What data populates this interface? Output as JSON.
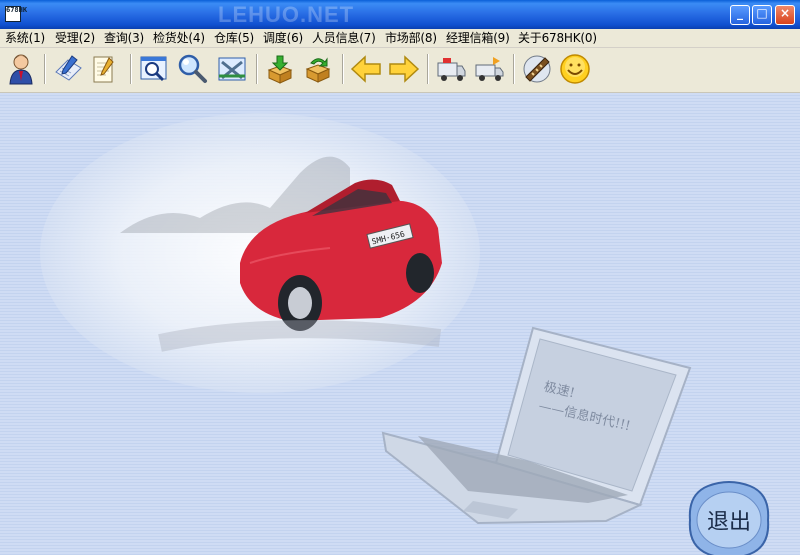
{
  "window": {
    "icon_text": "678HK",
    "watermark": "LEHUO.NET",
    "controls": {
      "minimize": "_",
      "maximize": "□",
      "close": "×"
    }
  },
  "menu": {
    "items": [
      {
        "label": "系统(1)"
      },
      {
        "label": "受理(2)"
      },
      {
        "label": "查询(3)"
      },
      {
        "label": "检货处(4)"
      },
      {
        "label": "仓库(5)"
      },
      {
        "label": "调度(6)"
      },
      {
        "label": "人员信息(7)"
      },
      {
        "label": "市场部(8)"
      },
      {
        "label": "经理信箱(9)"
      },
      {
        "label": "关于678HK(0)"
      }
    ]
  },
  "toolbar": {
    "buttons": [
      {
        "icon": "user-icon"
      },
      {
        "icon": "edit-form-icon"
      },
      {
        "icon": "notepad-icon"
      },
      {
        "icon": "search-window-icon"
      },
      {
        "icon": "magnifier-icon"
      },
      {
        "icon": "tools-window-icon"
      },
      {
        "icon": "download-box-icon"
      },
      {
        "icon": "refresh-box-icon"
      },
      {
        "icon": "arrow-left-icon"
      },
      {
        "icon": "arrow-right-icon"
      },
      {
        "icon": "truck-icon"
      },
      {
        "icon": "truck-return-icon"
      },
      {
        "icon": "film-icon"
      },
      {
        "icon": "smiley-icon"
      }
    ]
  },
  "desktop": {
    "plate_text": "SMH·656",
    "laptop_line1": "极速!",
    "laptop_line2": "——信息时代!!!",
    "exit_label": "退出"
  },
  "colors": {
    "titlebar": "#2a6fe6",
    "desktop_bg": "#cfdcf4",
    "car": "#d8283c"
  }
}
